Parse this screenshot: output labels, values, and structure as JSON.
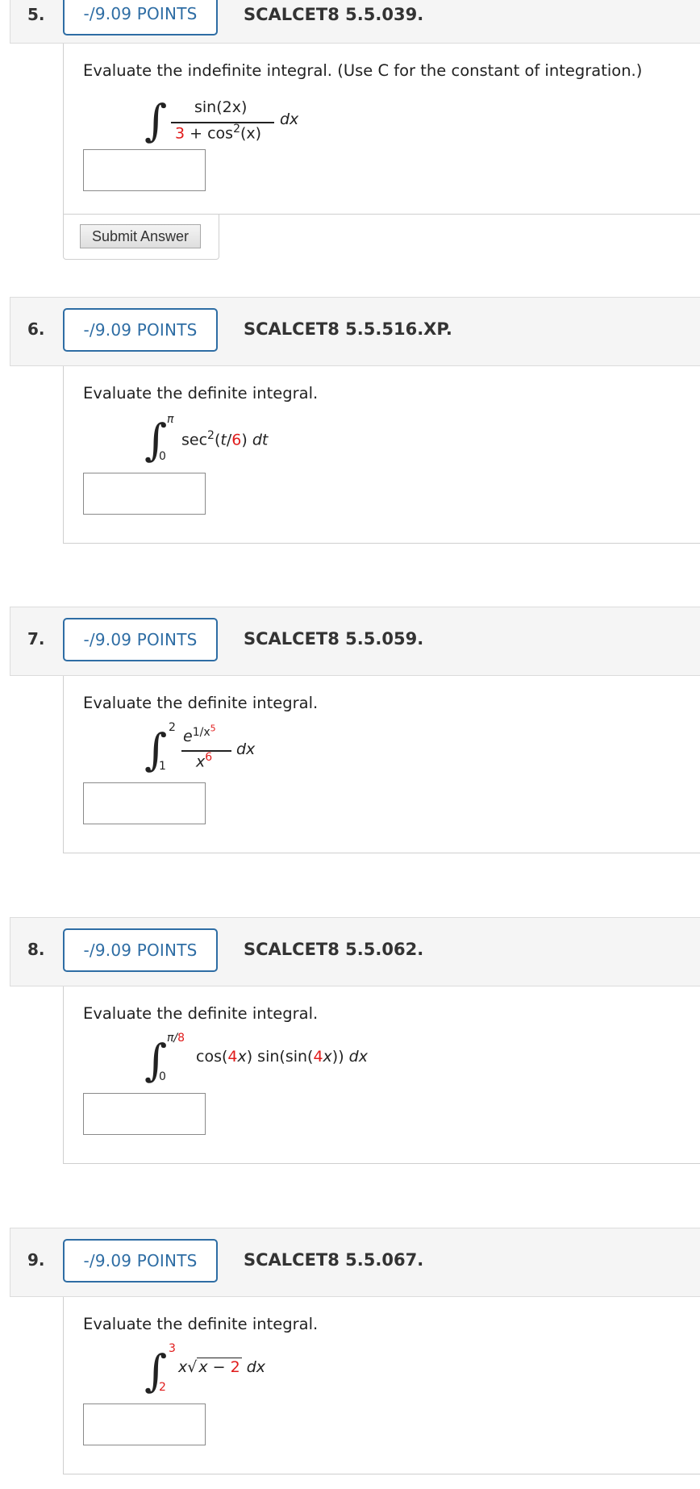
{
  "questions": [
    {
      "number": "5.",
      "points": "-/9.09 POINTS",
      "code": "SCALCET8 5.5.039.",
      "prompt": "Evaluate the indefinite integral. (Use C for the constant of integration.)",
      "numerator": "sin(2x)",
      "denominator_const": "3",
      "denominator_rest": " + cos",
      "denominator_exp": "2",
      "denominator_arg": "(x)",
      "differential": "dx",
      "answer_value": "",
      "submit_label": "Submit Answer"
    },
    {
      "number": "6.",
      "points": "-/9.09 POINTS",
      "code": "SCALCET8 5.5.516.XP.",
      "prompt": "Evaluate the definite integral.",
      "upper": "π",
      "lower": "0",
      "integrand_func": "sec",
      "integrand_exp": "2",
      "integrand_open": "(",
      "integrand_var": "t",
      "integrand_slash": "/",
      "integrand_const": "6",
      "integrand_close": ")",
      "differential": "dt",
      "answer_value": ""
    },
    {
      "number": "7.",
      "points": "-/9.09 POINTS",
      "code": "SCALCET8 5.5.059.",
      "prompt": "Evaluate the definite integral.",
      "upper": "2",
      "lower": "1",
      "numerator_base": "e",
      "numerator_exp_pre": "1/x",
      "numerator_exp_red": "5",
      "denominator_base": "x",
      "denominator_exp": "6",
      "differential": "dx",
      "answer_value": ""
    },
    {
      "number": "8.",
      "points": "-/9.09 POINTS",
      "code": "SCALCET8 5.5.062.",
      "prompt": "Evaluate the definite integral.",
      "upper_pi": "π/",
      "upper_red": "8",
      "lower": "0",
      "part1": "cos(",
      "part1_red": "4",
      "part1_var": "x",
      "part2": ") sin(sin(",
      "part2_red": "4",
      "part2_var": "x",
      "part3": ")) ",
      "differential": "dx",
      "answer_value": ""
    },
    {
      "number": "9.",
      "points": "-/9.09 POINTS",
      "code": "SCALCET8 5.5.067.",
      "prompt": "Evaluate the definite integral.",
      "upper": "3",
      "lower": "2",
      "outer_var": "x",
      "radicand_var": "x",
      "radicand_minus": " − ",
      "radicand_red": "2",
      "differential": "dx",
      "answer_value": ""
    }
  ],
  "colors": {
    "accent": "#2e6da4",
    "highlight": "#e01b1b",
    "header_bg": "#f5f5f5"
  }
}
